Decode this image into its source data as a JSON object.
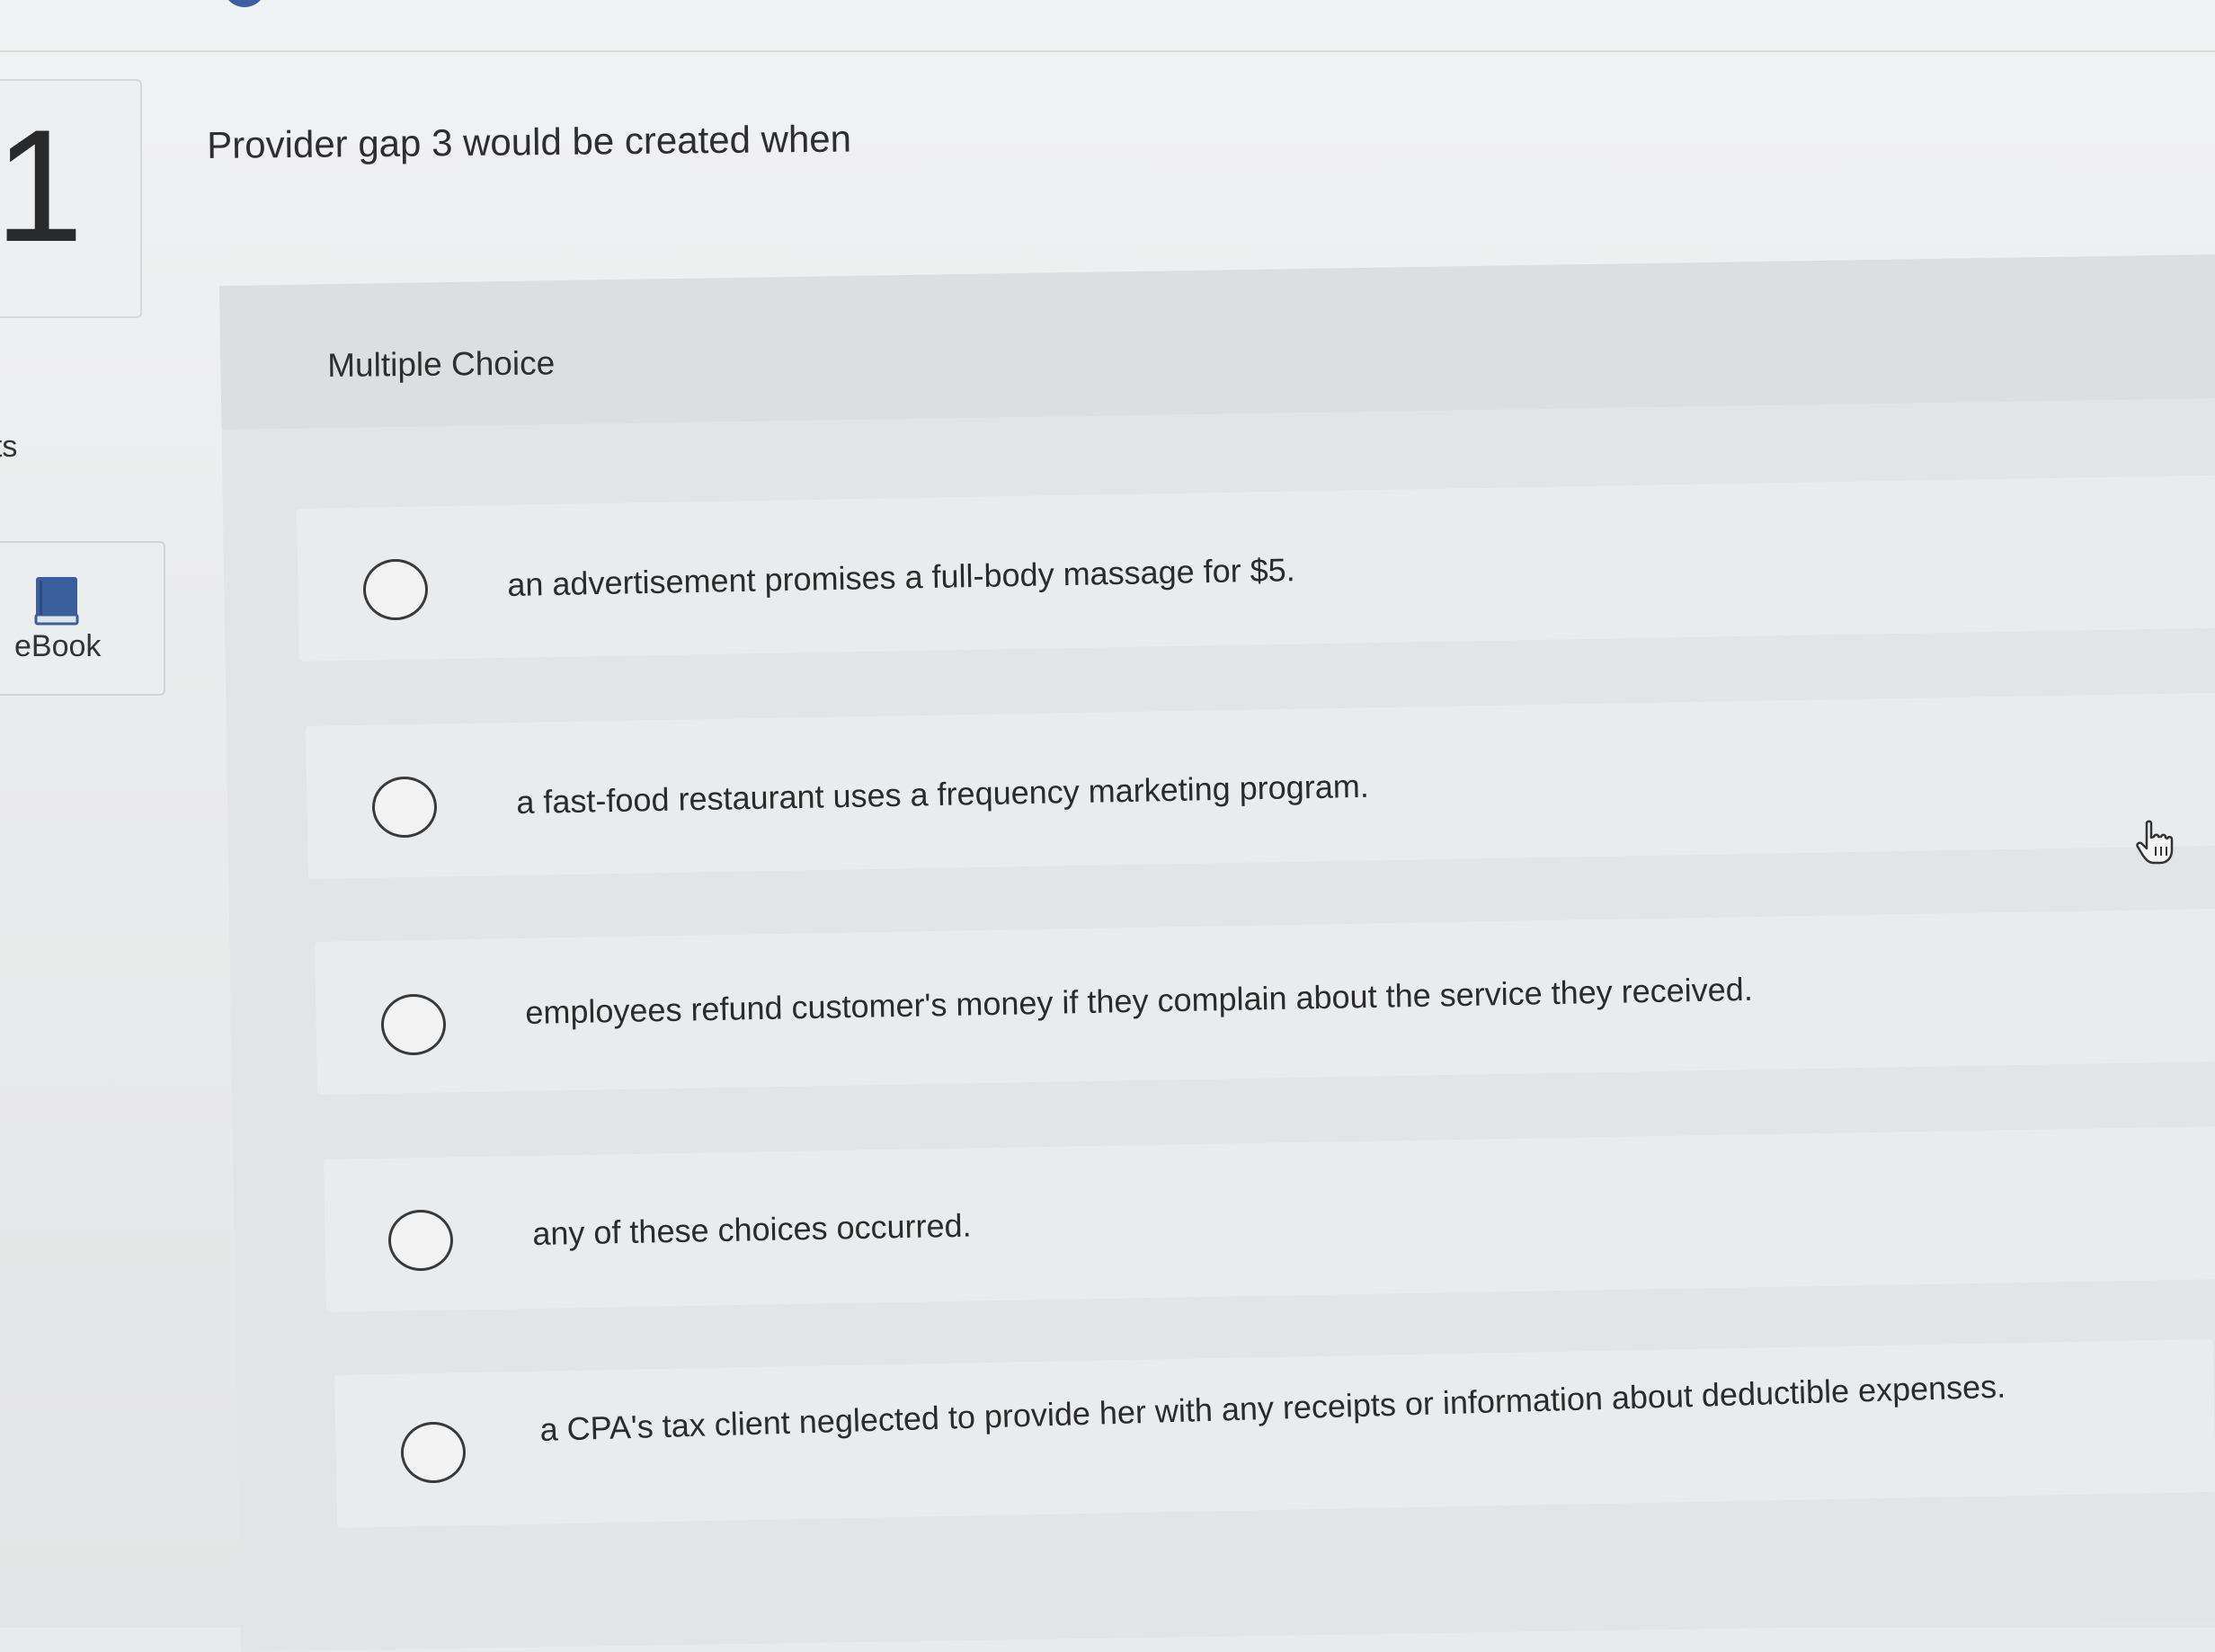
{
  "left_rail": {
    "question_number": "1",
    "points_label": "nts",
    "ebook_label": "eBook"
  },
  "question": {
    "prompt": "Provider gap 3 would be created when",
    "type_label": "Multiple Choice"
  },
  "options": [
    "an advertisement promises a full-body massage for $5.",
    "a fast-food restaurant uses a frequency marketing program.",
    "employees refund customer's money if they complain about the service they received.",
    "any of these choices occurred.",
    "a CPA's tax client neglected to provide her with any receipts or information about deductible expenses."
  ],
  "icons": {
    "ebook": "book-icon",
    "cursor": "hand-pointer-icon"
  },
  "colors": {
    "background": "#e9eaeb",
    "panel": "#e3e4e6",
    "text": "#2b2b2b",
    "ebook_icon": "#3b5f9c"
  }
}
